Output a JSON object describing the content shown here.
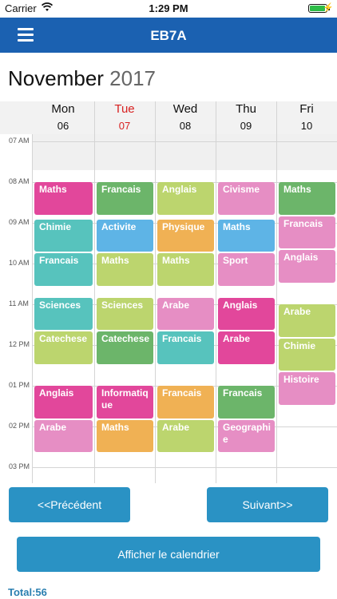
{
  "status": {
    "carrier": "Carrier",
    "time": "1:29 PM",
    "battery_fraction": 0.95
  },
  "nav": {
    "title": "EB7A"
  },
  "header": {
    "month": "November",
    "year": "2017"
  },
  "days": [
    {
      "name": "Mon",
      "date": "06",
      "today": false
    },
    {
      "name": "Tue",
      "date": "07",
      "today": true
    },
    {
      "name": "Wed",
      "date": "08",
      "today": false
    },
    {
      "name": "Thu",
      "date": "09",
      "today": false
    },
    {
      "name": "Fri",
      "date": "10",
      "today": false
    }
  ],
  "time_labels": [
    "07 AM",
    "08 AM",
    "09 AM",
    "10 AM",
    "11 AM",
    "12 PM",
    "01 PM",
    "02 PM",
    "03 PM"
  ],
  "colors": {
    "magenta": "#e2479b",
    "green": "#6cb56a",
    "lime": "#bcd56e",
    "pink": "#e68ec4",
    "teal": "#57c3bd",
    "blue": "#5eb4e6",
    "orange": "#f0b154"
  },
  "events": [
    {
      "label": "Maths",
      "day": 0,
      "start": "08:00",
      "end": "08:50",
      "color": "magenta"
    },
    {
      "label": "Chimie",
      "day": 0,
      "start": "08:55",
      "end": "09:45",
      "color": "teal"
    },
    {
      "label": "Francais",
      "day": 0,
      "start": "09:45",
      "end": "10:35",
      "color": "teal"
    },
    {
      "label": "Sciences",
      "day": 0,
      "start": "10:50",
      "end": "11:40",
      "color": "teal"
    },
    {
      "label": "Catechese",
      "day": 0,
      "start": "11:40",
      "end": "12:30",
      "color": "lime"
    },
    {
      "label": "Anglais",
      "day": 0,
      "start": "13:00",
      "end": "13:50",
      "color": "magenta"
    },
    {
      "label": "Arabe",
      "day": 0,
      "start": "13:50",
      "end": "14:40",
      "color": "pink"
    },
    {
      "label": "Francais",
      "day": 1,
      "start": "08:00",
      "end": "08:50",
      "color": "green"
    },
    {
      "label": "Activite",
      "day": 1,
      "start": "08:55",
      "end": "09:45",
      "color": "blue"
    },
    {
      "label": "Maths",
      "day": 1,
      "start": "09:45",
      "end": "10:35",
      "color": "lime"
    },
    {
      "label": "Sciences",
      "day": 1,
      "start": "10:50",
      "end": "11:40",
      "color": "lime"
    },
    {
      "label": "Catechese",
      "day": 1,
      "start": "11:40",
      "end": "12:30",
      "color": "green"
    },
    {
      "label": "Informatique",
      "day": 1,
      "start": "13:00",
      "end": "13:50",
      "color": "magenta"
    },
    {
      "label": "Maths",
      "day": 1,
      "start": "13:50",
      "end": "14:40",
      "color": "orange"
    },
    {
      "label": "Anglais",
      "day": 2,
      "start": "08:00",
      "end": "08:50",
      "color": "lime"
    },
    {
      "label": "Physique",
      "day": 2,
      "start": "08:55",
      "end": "09:45",
      "color": "orange"
    },
    {
      "label": "Maths",
      "day": 2,
      "start": "09:45",
      "end": "10:35",
      "color": "lime"
    },
    {
      "label": "Arabe",
      "day": 2,
      "start": "10:50",
      "end": "11:40",
      "color": "pink"
    },
    {
      "label": "Francais",
      "day": 2,
      "start": "11:40",
      "end": "12:30",
      "color": "teal"
    },
    {
      "label": "Francais",
      "day": 2,
      "start": "13:00",
      "end": "13:50",
      "color": "orange"
    },
    {
      "label": "Arabe",
      "day": 2,
      "start": "13:50",
      "end": "14:40",
      "color": "lime"
    },
    {
      "label": "Civisme",
      "day": 3,
      "start": "08:00",
      "end": "08:50",
      "color": "pink"
    },
    {
      "label": "Maths",
      "day": 3,
      "start": "08:55",
      "end": "09:45",
      "color": "blue"
    },
    {
      "label": "Sport",
      "day": 3,
      "start": "09:45",
      "end": "10:35",
      "color": "pink"
    },
    {
      "label": "Anglais",
      "day": 3,
      "start": "10:50",
      "end": "11:40",
      "color": "magenta"
    },
    {
      "label": "Arabe",
      "day": 3,
      "start": "11:40",
      "end": "12:30",
      "color": "magenta"
    },
    {
      "label": "Francais",
      "day": 3,
      "start": "13:00",
      "end": "13:50",
      "color": "green"
    },
    {
      "label": "Geographie",
      "day": 3,
      "start": "13:50",
      "end": "14:40",
      "color": "pink"
    },
    {
      "label": "Maths",
      "day": 4,
      "start": "08:00",
      "end": "08:50",
      "color": "green"
    },
    {
      "label": "Francais",
      "day": 4,
      "start": "08:50",
      "end": "09:40",
      "color": "pink"
    },
    {
      "label": "Anglais",
      "day": 4,
      "start": "09:40",
      "end": "10:30",
      "color": "pink"
    },
    {
      "label": "Arabe",
      "day": 4,
      "start": "11:00",
      "end": "11:50",
      "color": "lime"
    },
    {
      "label": "Chimie",
      "day": 4,
      "start": "11:50",
      "end": "12:40",
      "color": "lime"
    },
    {
      "label": "Histoire",
      "day": 4,
      "start": "12:40",
      "end": "13:30",
      "color": "pink"
    }
  ],
  "buttons": {
    "prev": "<<Précédent",
    "next": "Suivant>>",
    "show": "Afficher le calendrier"
  },
  "footer": {
    "total": "Total:56"
  }
}
